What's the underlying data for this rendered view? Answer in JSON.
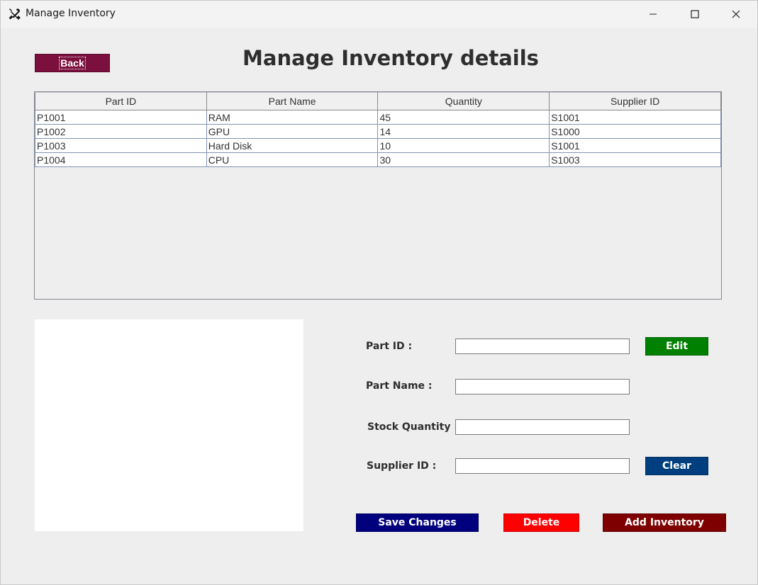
{
  "window": {
    "title": "Manage Inventory"
  },
  "header": {
    "back_label": "Back",
    "page_title": "Manage Inventory details"
  },
  "table": {
    "columns": [
      "Part ID",
      "Part Name",
      "Quantity",
      "Supplier ID"
    ],
    "rows": [
      [
        "P1001",
        "RAM",
        "45",
        "S1001"
      ],
      [
        "P1002",
        "GPU",
        "14",
        "S1000"
      ],
      [
        "P1003",
        "Hard Disk",
        "10",
        "S1001"
      ],
      [
        "P1004",
        "CPU",
        "30",
        "S1003"
      ]
    ]
  },
  "form": {
    "part_id_label": "Part ID :",
    "part_name_label": "Part Name :",
    "stock_quantity_label": "Stock Quantity :",
    "supplier_id_label": "Supplier ID :",
    "part_id_value": "",
    "part_name_value": "",
    "stock_quantity_value": "",
    "supplier_id_value": ""
  },
  "buttons": {
    "edit": "Edit",
    "clear": "Clear",
    "save_changes": "Save Changes",
    "delete": "Delete",
    "add_inventory": "Add Inventory"
  },
  "colors": {
    "back": "#7b0f3d",
    "edit": "#008000",
    "clear": "#003f7f",
    "save_changes": "#00007f",
    "delete": "#ff0000",
    "add_inventory": "#7f0000"
  },
  "icons": {
    "app": "tools-icon",
    "minimize": "minimize-icon",
    "maximize": "maximize-icon",
    "close": "close-icon"
  }
}
